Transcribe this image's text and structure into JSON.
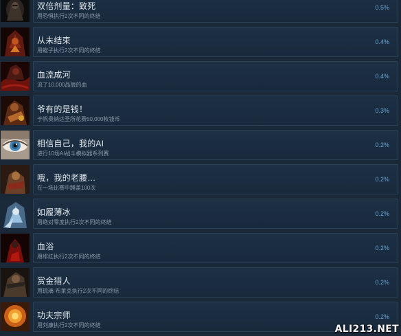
{
  "achievements": [
    {
      "title": "双倍剂量：致死",
      "description": "用恐惧执行2次不同的终结",
      "percent": "0.5%",
      "icon": "dark-warrior-icon"
    },
    {
      "title": "从未结束",
      "description": "用蠍子执行2次不同的终结",
      "percent": "0.4%",
      "icon": "scorpion-icon"
    },
    {
      "title": "血流成河",
      "description": "流了10,000品脱的血",
      "percent": "0.4%",
      "icon": "blood-river-icon"
    },
    {
      "title": "爷有的是钱！",
      "description": "于帆贵纳达圣所花费50,000枚钱币",
      "percent": "0.3%",
      "icon": "money-icon"
    },
    {
      "title": "相信自己，我的AI",
      "description": "进行10场AI战斗模拟器系列赛",
      "percent": "0.2%",
      "icon": "eye-icon"
    },
    {
      "title": "哦，我的老腰…",
      "description": "在一场比赛中蹲盖100次",
      "percent": "0.2%",
      "icon": "old-back-icon"
    },
    {
      "title": "如履薄冰",
      "description": "用绝对零度执行2次不同的终结",
      "percent": "0.2%",
      "icon": "ice-icon"
    },
    {
      "title": "血浴",
      "description": "用绯红执行2次不同的终结",
      "percent": "0.2%",
      "icon": "blood-bath-icon"
    },
    {
      "title": "赏金猎人",
      "description": "用琉璃·布莱克执行2次不同的终结",
      "percent": "0.2%",
      "icon": "bounty-hunter-icon"
    },
    {
      "title": "功夫宗师",
      "description": "用刘康执行2次不同的终结",
      "percent": "0.2%",
      "icon": "kung-fu-icon"
    }
  ],
  "watermark": "ALI213.NET"
}
